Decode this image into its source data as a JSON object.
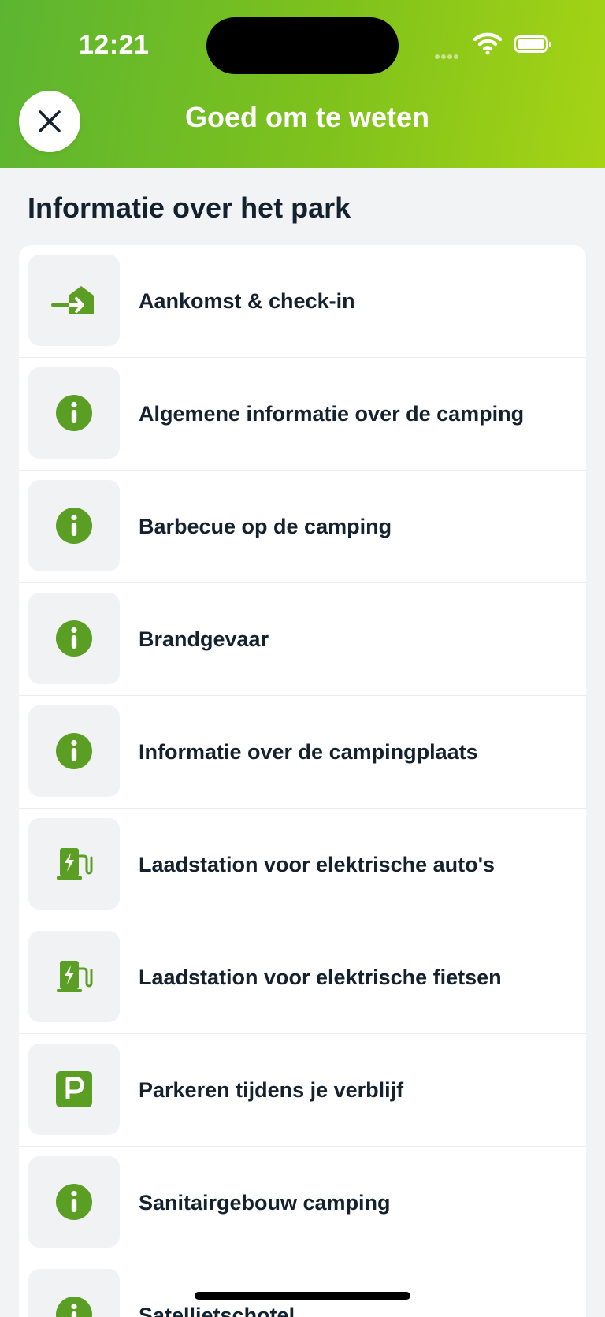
{
  "status_bar": {
    "time": "12:21"
  },
  "header": {
    "title": "Goed om te weten"
  },
  "section": {
    "title": "Informatie over het park"
  },
  "colors": {
    "accent": "#5a9e23",
    "header_start": "#5cb531",
    "header_end": "#a6d415"
  },
  "items": [
    {
      "label": "Aankomst & check-in",
      "icon": "arrival-icon"
    },
    {
      "label": "Algemene informatie over de camping",
      "icon": "info-icon"
    },
    {
      "label": "Barbecue op de camping",
      "icon": "info-icon"
    },
    {
      "label": "Brandgevaar",
      "icon": "info-icon"
    },
    {
      "label": "Informatie over de campingplaats",
      "icon": "info-icon"
    },
    {
      "label": "Laadstation voor elektrische auto's",
      "icon": "charging-station-icon"
    },
    {
      "label": "Laadstation voor elektrische fietsen",
      "icon": "charging-station-icon"
    },
    {
      "label": "Parkeren tijdens je verblijf",
      "icon": "parking-icon"
    },
    {
      "label": "Sanitairgebouw camping",
      "icon": "info-icon"
    },
    {
      "label": "Satellietschotel",
      "icon": "info-icon"
    }
  ]
}
